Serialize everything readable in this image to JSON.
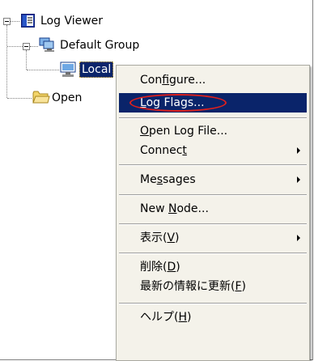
{
  "tree": {
    "root": "Log Viewer",
    "group": "Default Group",
    "node": "Local",
    "folder": "Open"
  },
  "menu": {
    "items": [
      {
        "label": "Configure...",
        "accel": "f",
        "pre": "Con",
        "post": "igure..."
      },
      {
        "label": "Log Flags...",
        "accel": "L",
        "pre": "",
        "post": "og Flags...",
        "selected": true
      },
      {
        "label": "Open Log File...",
        "accel": "O",
        "pre": "",
        "post": "pen Log File..."
      },
      {
        "label": "Connect",
        "accel": "t",
        "pre": "Connec",
        "post": "",
        "submenu": true
      },
      {
        "label": "Messages",
        "accel": "s",
        "pre": "Me",
        "post": "sages",
        "submenu": true
      },
      {
        "label": "New Node...",
        "accel": "N",
        "pre": "New ",
        "post": "ode..."
      },
      {
        "label": "表示(V)",
        "accel": "V",
        "pre": "表示(",
        "post": ")",
        "submenu": true
      },
      {
        "label": "削除(D)",
        "accel": "D",
        "pre": "削除(",
        "post": ")"
      },
      {
        "label": "最新の情報に更新(F)",
        "accel": "F",
        "pre": "最新の情報に更新(",
        "post": ")"
      },
      {
        "label": "ヘルプ(H)",
        "accel": "H",
        "pre": "ヘルプ(",
        "post": ")"
      }
    ]
  },
  "colors": {
    "selection": "#0a246a",
    "menu_bg": "#f4f2ea",
    "highlight_circle": "#e0201c"
  },
  "icons": [
    "log-viewer-icon",
    "group-icon",
    "computer-icon",
    "folder-icon",
    "submenu-arrow-icon"
  ]
}
